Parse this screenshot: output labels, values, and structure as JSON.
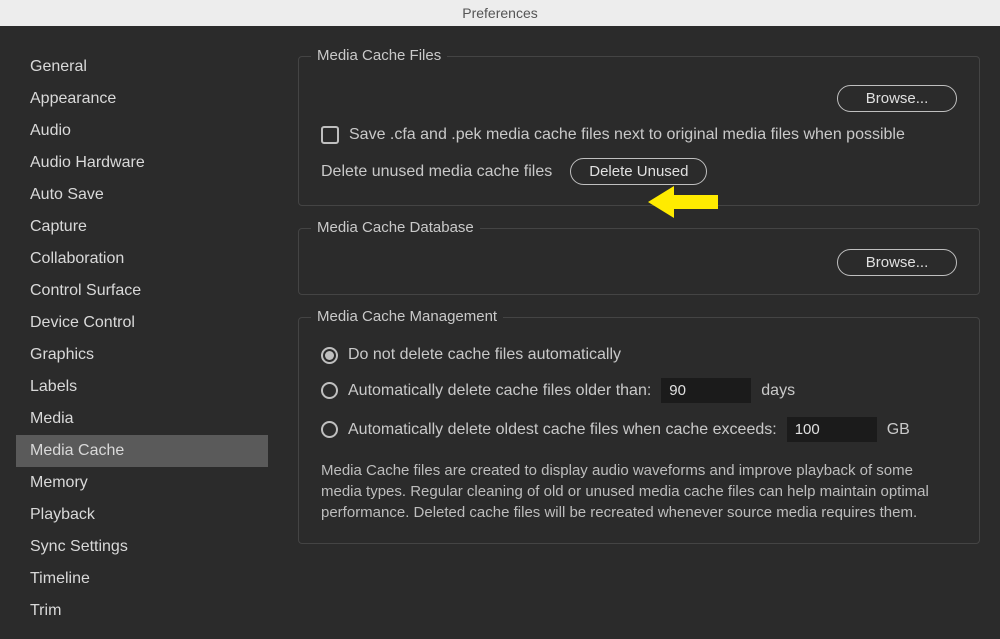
{
  "title": "Preferences",
  "sidebar": {
    "items": [
      {
        "label": "General"
      },
      {
        "label": "Appearance"
      },
      {
        "label": "Audio"
      },
      {
        "label": "Audio Hardware"
      },
      {
        "label": "Auto Save"
      },
      {
        "label": "Capture"
      },
      {
        "label": "Collaboration"
      },
      {
        "label": "Control Surface"
      },
      {
        "label": "Device Control"
      },
      {
        "label": "Graphics"
      },
      {
        "label": "Labels"
      },
      {
        "label": "Media"
      },
      {
        "label": "Media Cache"
      },
      {
        "label": "Memory"
      },
      {
        "label": "Playback"
      },
      {
        "label": "Sync Settings"
      },
      {
        "label": "Timeline"
      },
      {
        "label": "Trim"
      }
    ],
    "selectedIndex": 12
  },
  "cacheFiles": {
    "title": "Media Cache Files",
    "browse": "Browse...",
    "saveNextTo": "Save .cfa and .pek media cache files next to original media files when possible",
    "deleteLabel": "Delete unused media cache files",
    "deleteButton": "Delete Unused"
  },
  "cacheDb": {
    "title": "Media Cache Database",
    "browse": "Browse..."
  },
  "management": {
    "title": "Media Cache Management",
    "optNoDelete": "Do not delete cache files automatically",
    "optOlder": "Automatically delete cache files older than:",
    "optOlderValue": "90",
    "optOlderUnit": "days",
    "optExceeds": "Automatically delete oldest cache files when cache exceeds:",
    "optExceedsValue": "100",
    "optExceedsUnit": "GB",
    "description": "Media Cache files are created to display audio waveforms and improve playback of some media types.  Regular cleaning of old or unused media cache files can help maintain optimal performance. Deleted cache files will be recreated whenever source media requires them."
  }
}
